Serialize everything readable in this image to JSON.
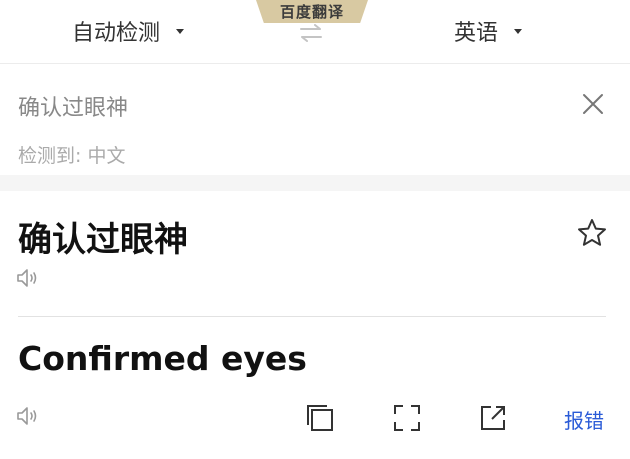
{
  "brand": {
    "label": "百度翻译"
  },
  "languages": {
    "source": "自动检测",
    "target": "英语"
  },
  "input": {
    "text": "确认过眼神",
    "detected": "检测到:  中文"
  },
  "result": {
    "source_text": "确认过眼神",
    "translation": "Confirmed eyes",
    "report_label": "报错"
  },
  "colors": {
    "brand_tab": "#d8c9a2",
    "link": "#2a5bd7",
    "separator": "#f5f5f5"
  },
  "icons": [
    "swap-icon",
    "clear-icon",
    "star-icon",
    "speaker-icon",
    "copy-icon",
    "fullscreen-icon",
    "share-icon",
    "caret-down-icon"
  ]
}
